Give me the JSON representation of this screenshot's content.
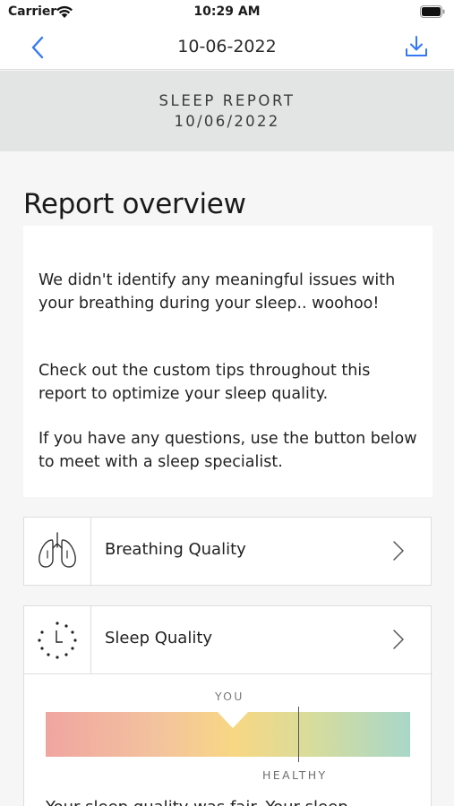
{
  "status_bar": {
    "carrier": "Carrier",
    "time": "10:29 AM"
  },
  "nav": {
    "title": "10-06-2022",
    "back_icon": "chevron-left-icon",
    "download_icon": "download-icon"
  },
  "banner": {
    "title": "SLEEP REPORT",
    "date": "10/06/2022"
  },
  "overview": {
    "heading": "Report overview",
    "paragraphs": [
      "We didn't identify any meaningful issues with your breathing during your sleep.. woohoo!",
      "Check out the custom tips throughout this report to optimize your sleep quality.",
      "If you have any questions, use the button below to meet with a sleep specialist."
    ]
  },
  "quality_rows": [
    {
      "label": "Breathing Quality",
      "icon": "lungs-icon"
    },
    {
      "label": "Sleep Quality",
      "icon": "clock-icon"
    }
  ],
  "sleep_gauge": {
    "marker_label": "YOU",
    "reference_label": "HEALTHY",
    "summary": "Your sleep quality was fair. Your sleep",
    "you_position": 0.51,
    "healthy_position": 0.73
  },
  "colors": {
    "accent": "#3478f6",
    "banner_bg": "#e3e5e4",
    "gauge_start": "#f0a5a0",
    "gauge_mid": "#f7d784",
    "gauge_end": "#a8d7c9"
  }
}
